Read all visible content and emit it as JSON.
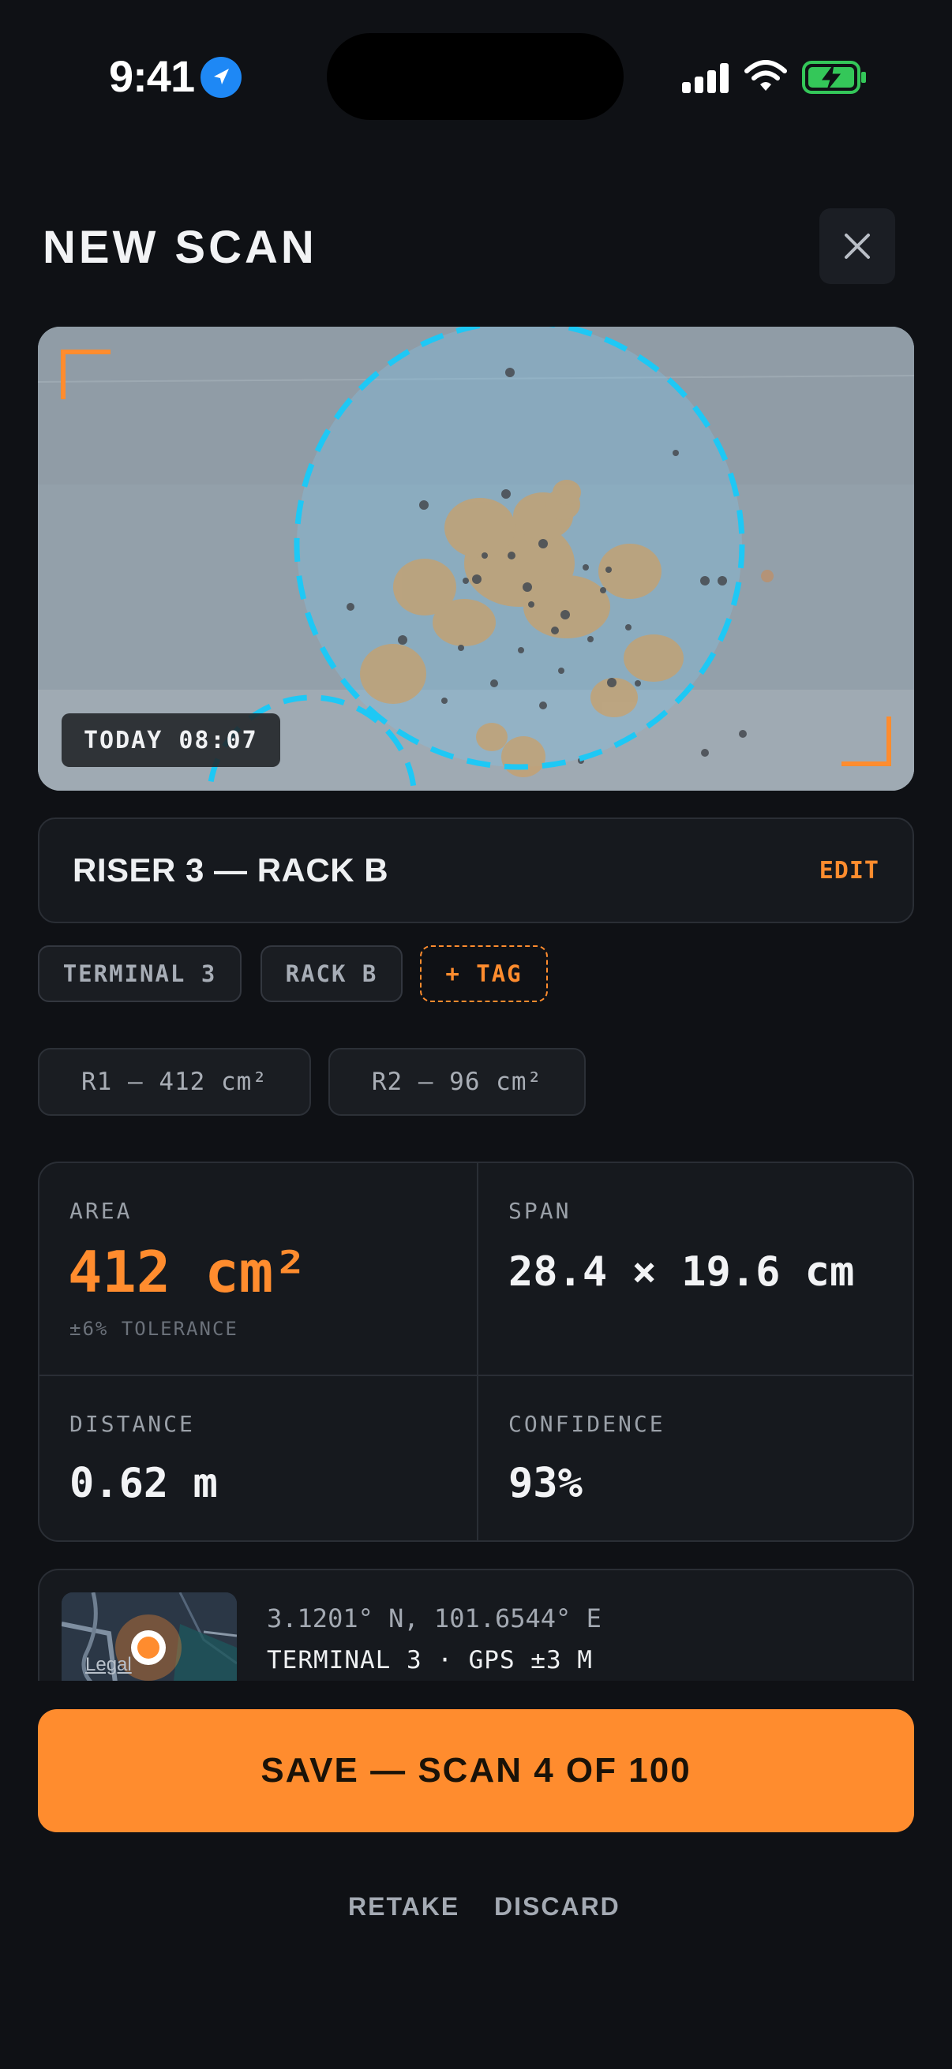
{
  "status_bar": {
    "time": "9:41"
  },
  "header": {
    "title": "NEW SCAN",
    "close_icon": "close-icon"
  },
  "camera": {
    "timestamp": "TODAY 08:07",
    "colors": {
      "detection_ring": "#1ec8f5",
      "frame_corner": "#ff8c2e"
    }
  },
  "scan_name": {
    "label": "RISER 3 — RACK B",
    "edit_label": "EDIT"
  },
  "tags": [
    {
      "label": "TERMINAL 3"
    },
    {
      "label": "RACK B"
    }
  ],
  "add_tag_label": "+ TAG",
  "regions": [
    {
      "label": "R1 — 412 cm²"
    },
    {
      "label": "R2 — 96 cm²"
    }
  ],
  "metrics": {
    "area": {
      "label": "AREA",
      "value": "412 cm²",
      "sub": "±6% TOLERANCE"
    },
    "span": {
      "label": "SPAN",
      "value": "28.4 × 19.6 cm"
    },
    "distance": {
      "label": "DISTANCE",
      "value": "0.62 m"
    },
    "confidence": {
      "label": "CONFIDENCE",
      "value": "93%"
    }
  },
  "location": {
    "map_legal": "Legal",
    "coordinates": "3.1201° N, 101.6544° E",
    "detail": "TERMINAL 3 · GPS ±3 M"
  },
  "actions": {
    "save_label": "SAVE — SCAN 4 OF 100",
    "retake_label": "RETAKE",
    "discard_label": "DISCARD"
  },
  "colors": {
    "accent": "#ff8c2e",
    "background": "#0f1115",
    "card": "#16191e"
  }
}
